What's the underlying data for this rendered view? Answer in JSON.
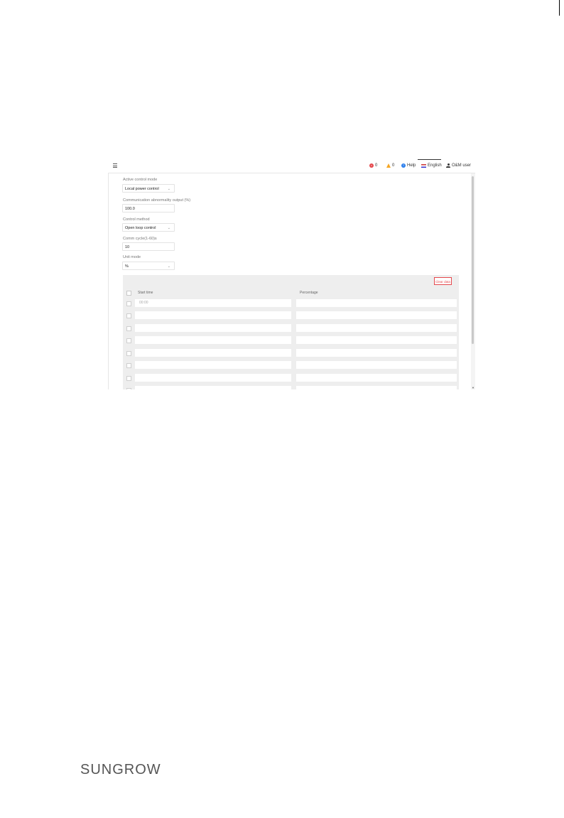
{
  "topbar": {
    "errors": "0",
    "warnings": "0",
    "help": "Help",
    "language": "English",
    "user": "O&M user"
  },
  "form": {
    "active_control_mode": {
      "label": "Active control mode",
      "value": "Local power control"
    },
    "comm_abnormality_output": {
      "label": "Communication abnormality output (%)",
      "value": "100.0"
    },
    "control_method": {
      "label": "Control method",
      "value": "Open loop control"
    },
    "comm_cycle": {
      "label": "Comm cycle(1-60)s",
      "value": "10"
    },
    "unit_mode": {
      "label": "Unit mode",
      "value": "%"
    }
  },
  "table": {
    "clear_button": "Clear data",
    "columns": [
      "Start time",
      "Percentage"
    ],
    "rows": [
      {
        "start": "00:00",
        "pct": ""
      },
      {
        "start": "",
        "pct": ""
      },
      {
        "start": "",
        "pct": ""
      },
      {
        "start": "",
        "pct": ""
      },
      {
        "start": "",
        "pct": ""
      },
      {
        "start": "",
        "pct": ""
      },
      {
        "start": "",
        "pct": ""
      },
      {
        "start": "",
        "pct": ""
      }
    ]
  },
  "footer": {
    "logo": "SUNGROW"
  }
}
